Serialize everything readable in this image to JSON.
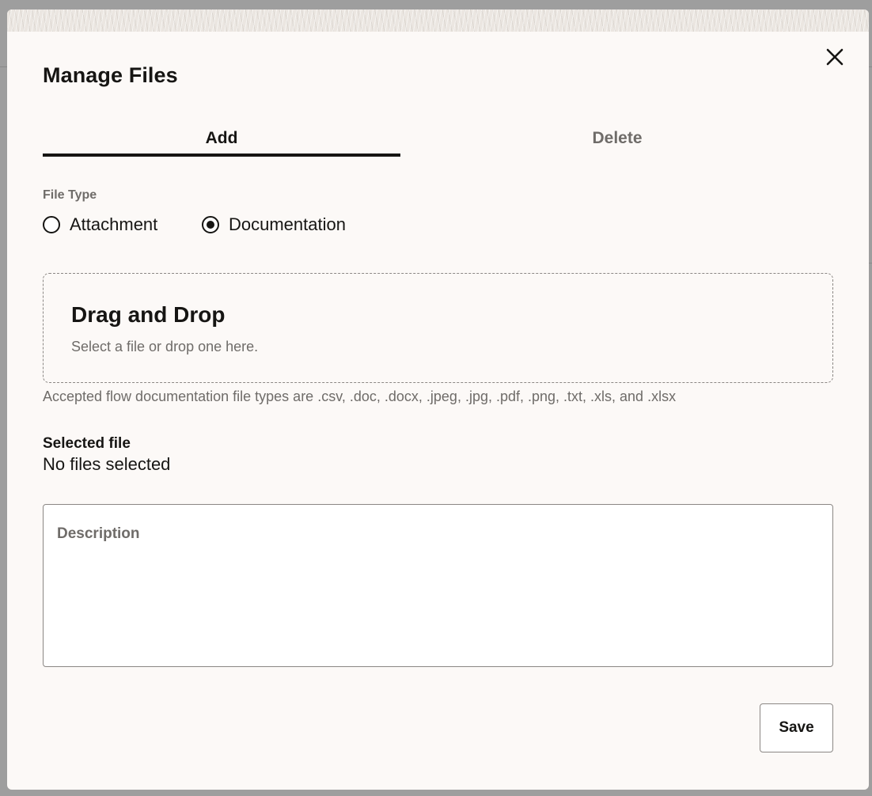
{
  "dialog": {
    "title": "Manage Files",
    "close_icon": "close-icon"
  },
  "tabs": [
    {
      "label": "Add",
      "selected": true
    },
    {
      "label": "Delete",
      "selected": false
    }
  ],
  "file_type": {
    "label": "File Type",
    "options": [
      {
        "label": "Attachment",
        "checked": false
      },
      {
        "label": "Documentation",
        "checked": true
      }
    ]
  },
  "dropzone": {
    "title": "Drag and Drop",
    "subtitle": "Select a file or drop one here."
  },
  "help_text": "Accepted flow documentation file types are .csv, .doc, .docx, .jpeg, .jpg, .pdf, .png, .txt, .xls, and .xlsx",
  "selected_file": {
    "label": "Selected file",
    "value": "No files selected"
  },
  "description": {
    "placeholder": "Description",
    "value": ""
  },
  "footer": {
    "save_label": "Save"
  },
  "colors": {
    "dialog_bg": "#fcf9f7",
    "text_primary": "#161513",
    "text_secondary": "#6f6c69",
    "border": "#8b8784",
    "backdrop": "#9e9e9e"
  }
}
